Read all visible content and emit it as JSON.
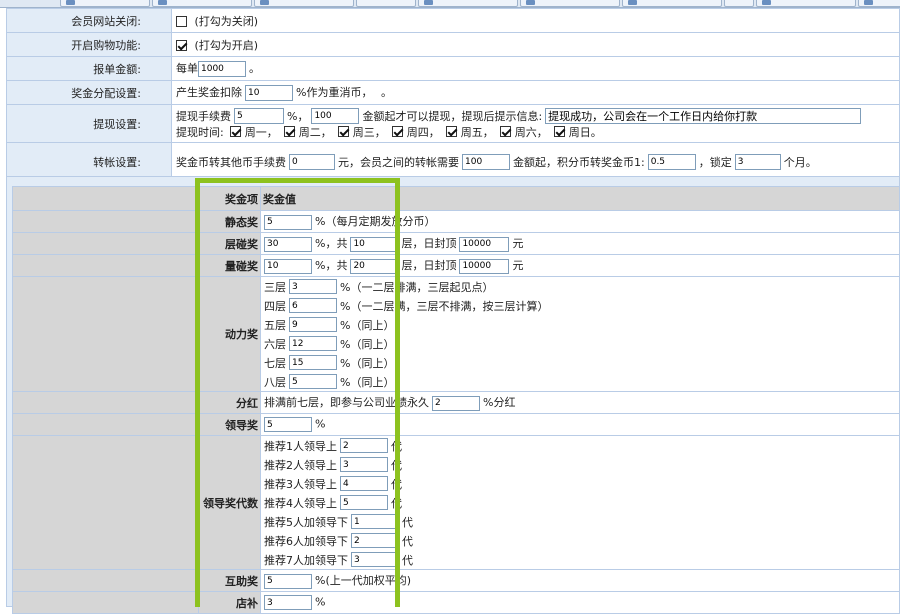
{
  "settings": {
    "site_close": {
      "label": "会员网站关闭:",
      "checked": false,
      "hint": "(打勾为关闭)"
    },
    "shop_open": {
      "label": "开启购物功能:",
      "checked": true,
      "hint": "(打勾为开启)"
    },
    "order_amount": {
      "label": "报单金额:",
      "prefix": "每单",
      "value": "1000",
      "suffix": "。"
    },
    "bonus_alloc": {
      "label": "奖金分配设置:",
      "prefix": "产生奖金扣除",
      "value": "10",
      "suffix": "%作为重消币，",
      "tail": "。"
    },
    "withdraw": {
      "label": "提现设置:",
      "fee_label": "提现手续费",
      "fee_value": "5",
      "fee_unit": "%，",
      "min_value": "100",
      "min_text": "金额起才可以提现，提现后提示信息:",
      "msg_value": "提现成功，公司会在一个工作日内给你打款",
      "time_label": "提现时间:",
      "days": [
        {
          "label": "周一，",
          "checked": true
        },
        {
          "label": "周二，",
          "checked": true
        },
        {
          "label": "周三，",
          "checked": true
        },
        {
          "label": "周四，",
          "checked": true
        },
        {
          "label": "周五，",
          "checked": true
        },
        {
          "label": "周六，",
          "checked": true
        },
        {
          "label": "周日。",
          "checked": true
        }
      ]
    },
    "transfer": {
      "label": "转帐设置:",
      "fee_label": "奖金币转其他币手续费",
      "fee_value": "0",
      "mid_text": "元，会员之间的转帐需要",
      "min_value": "100",
      "ratio_text": "金额起，积分币转奖金币1:",
      "ratio_value": "0.5",
      "lock_text": "，锁定",
      "lock_value": "3",
      "month_text": "个月。"
    }
  },
  "bonus": {
    "head": {
      "name": "奖金项",
      "value": "奖金值"
    },
    "static": {
      "name": "静态奖",
      "value": "5",
      "text": "%（每月定期发放分币）"
    },
    "layer": {
      "name": "层碰奖",
      "value": "30",
      "t1": "%，共",
      "layers": "10",
      "t2": "层，日封顶",
      "cap": "10000",
      "t3": "元"
    },
    "volume": {
      "name": "量碰奖",
      "value": "10",
      "t1": "%，共",
      "layers": "20",
      "t2": "层，日封顶",
      "cap": "10000",
      "t3": "元"
    },
    "power": {
      "name": "动力奖",
      "rows": [
        {
          "label": "三层",
          "value": "3",
          "note": "%（一二层排满，三层起见点）"
        },
        {
          "label": "四层",
          "value": "6",
          "note": "%（一二层满，三层不排满，按三层计算）"
        },
        {
          "label": "五层",
          "value": "9",
          "note": "%（同上）"
        },
        {
          "label": "六层",
          "value": "12",
          "note": "%（同上）"
        },
        {
          "label": "七层",
          "value": "15",
          "note": "%（同上）"
        },
        {
          "label": "八层",
          "value": "5",
          "note": "%（同上）"
        }
      ]
    },
    "dividend": {
      "name": "分红",
      "text": "排满前七层，即参与公司业绩永久",
      "value": "2",
      "suffix": "%分红"
    },
    "leader": {
      "name": "领导奖",
      "value": "5",
      "unit": "%"
    },
    "leader_gen": {
      "name": "领导奖代数",
      "rows": [
        {
          "label": "推荐1人领导上",
          "value": "2",
          "unit": "代"
        },
        {
          "label": "推荐2人领导上",
          "value": "3",
          "unit": "代"
        },
        {
          "label": "推荐3人领导上",
          "value": "4",
          "unit": "代"
        },
        {
          "label": "推荐4人领导上",
          "value": "5",
          "unit": "代"
        },
        {
          "label": "推荐5人加领导下",
          "value": "1",
          "unit": "代"
        },
        {
          "label": "推荐6人加领导下",
          "value": "2",
          "unit": "代"
        },
        {
          "label": "推荐7人加领导下",
          "value": "3",
          "unit": "代"
        }
      ]
    },
    "mutual": {
      "name": "互助奖",
      "value": "5",
      "text": "%(上一代加权平均)"
    },
    "store": {
      "name": "店补",
      "value": "3",
      "unit": "%"
    }
  },
  "colors": {
    "highlight": "#8dc21f",
    "label_bg": "#e2ecf7",
    "grid_border": "#b9cce6"
  }
}
